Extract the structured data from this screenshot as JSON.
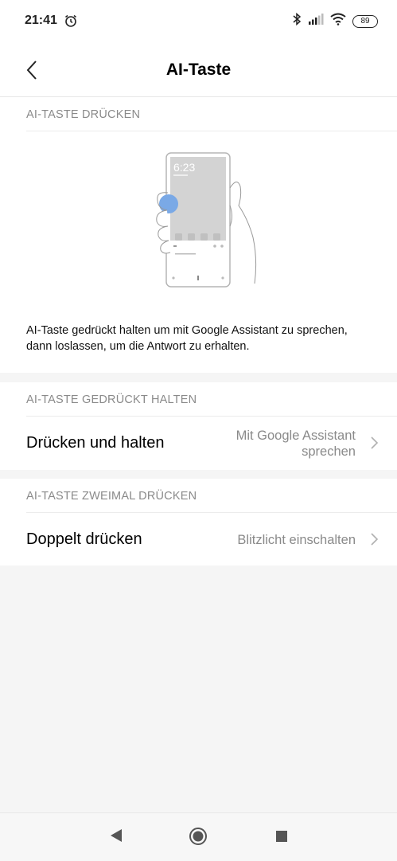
{
  "status_bar": {
    "time": "21:41",
    "battery": "89",
    "icons": [
      "alarm-icon",
      "bluetooth-icon",
      "signal-icon",
      "wifi-icon",
      "battery-icon"
    ]
  },
  "header": {
    "title": "AI-Taste"
  },
  "section_press": {
    "header": "AI-TASTE DRÜCKEN",
    "illustration_time": "6:23",
    "description": "AI-Taste gedrückt halten um mit Google Assistant zu sprechen, dann loslassen, um die Antwort zu erhalten."
  },
  "section_hold": {
    "header": "AI-TASTE GEDRÜCKT HALTEN",
    "row_label": "Drücken und halten",
    "row_value_line1": "Mit Google Assistant",
    "row_value_line2": "sprechen"
  },
  "section_double": {
    "header": "AI-TASTE ZWEIMAL DRÜCKEN",
    "row_label": "Doppelt drücken",
    "row_value": "Blitzlicht einschalten"
  },
  "nav": {
    "buttons": [
      "back-triangle",
      "home-circle",
      "recents-square"
    ]
  },
  "colors": {
    "accent_blue": "#7aa9e6",
    "text_secondary": "#8a8a8a",
    "background": "#f5f5f5"
  }
}
